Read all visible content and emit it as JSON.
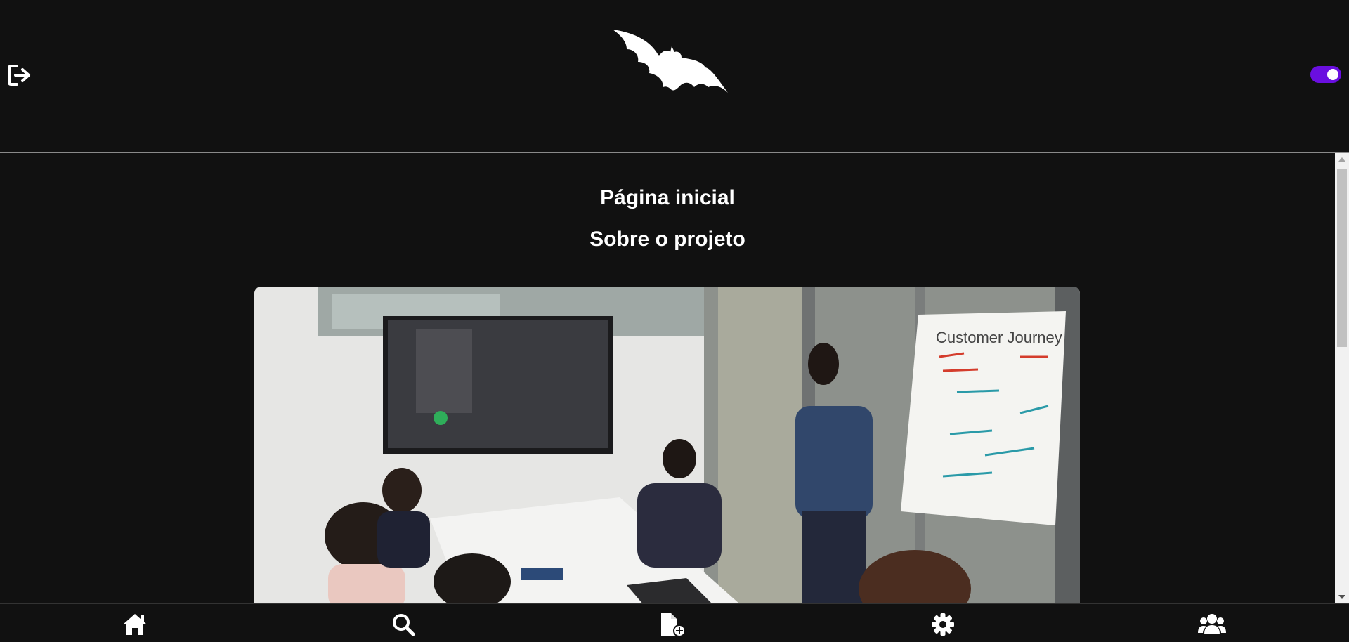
{
  "header": {
    "logout_icon": "logout-icon",
    "logo_icon": "bat-icon",
    "theme_toggle": {
      "on": true,
      "color": "#6a0fe0"
    }
  },
  "main": {
    "title": "Página inicial",
    "subtitle": "Sobre o projeto",
    "image_alt": "team-meeting-photo"
  },
  "bottom_nav": {
    "items": [
      {
        "icon": "home-icon"
      },
      {
        "icon": "search-icon"
      },
      {
        "icon": "add-document-icon"
      },
      {
        "icon": "settings-icon"
      },
      {
        "icon": "users-icon"
      }
    ]
  }
}
